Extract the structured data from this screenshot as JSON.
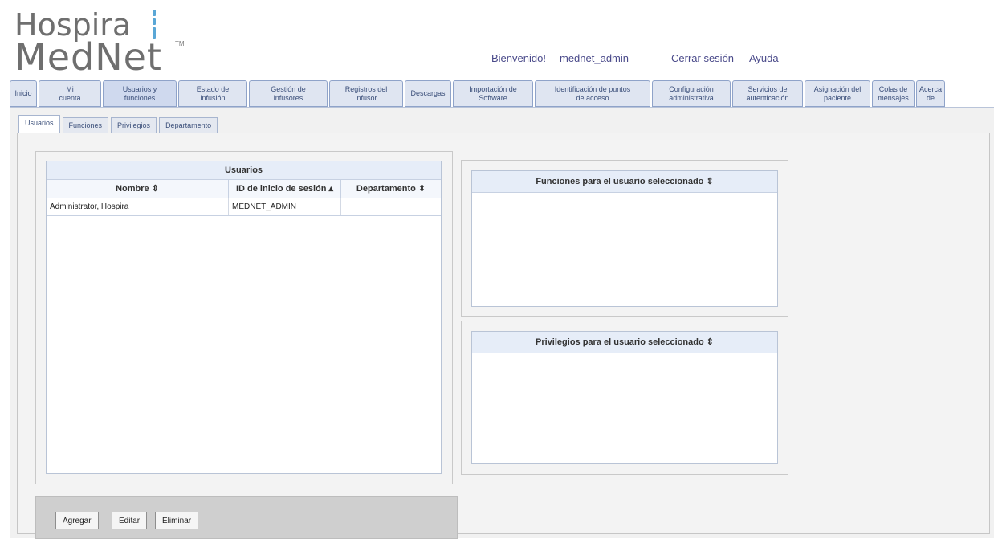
{
  "logo": {
    "line1": "Hospira",
    "line2": "MedNet",
    "tm": "TM"
  },
  "header": {
    "welcome": "Bienvenido!",
    "user": "mednet_admin",
    "logout": "Cerrar sesión",
    "help": "Ayuda"
  },
  "nav": {
    "tabs": [
      {
        "label": "Inicio"
      },
      {
        "label": "Mi\ncuenta"
      },
      {
        "label": "Usuarios y\nfunciones"
      },
      {
        "label": "Estado de\ninfusión"
      },
      {
        "label": "Gestión de\ninfusores"
      },
      {
        "label": "Registros del\ninfusor"
      },
      {
        "label": "Descargas"
      },
      {
        "label": "Importación de\nSoftware"
      },
      {
        "label": "Identificación de puntos\nde acceso"
      },
      {
        "label": "Configuración\nadministrativa"
      },
      {
        "label": "Servicios de\nautenticación"
      },
      {
        "label": "Asignación del\npaciente"
      },
      {
        "label": "Colas de\nmensajes"
      },
      {
        "label": "Acerca\nde"
      }
    ],
    "active_index": 2
  },
  "subtabs": {
    "items": [
      "Usuarios",
      "Funciones",
      "Privilegios",
      "Departamento"
    ],
    "active_index": 0
  },
  "users_table": {
    "title": "Usuarios",
    "columns": [
      "Nombre ⇕",
      "ID de inicio de sesión ▴",
      "Departamento ⇕"
    ],
    "rows": [
      {
        "name": "Administrator, Hospira",
        "login_id": "MEDNET_ADMIN",
        "department": ""
      }
    ]
  },
  "roles_panel": {
    "title": "Funciones para el usuario seleccionado ⇕"
  },
  "privileges_panel": {
    "title": "Privilegios para el usuario seleccionado ⇕"
  },
  "buttons": {
    "add": "Agregar",
    "edit": "Editar",
    "delete": "Eliminar"
  },
  "colors": {
    "tab_bg": "#dfe5f1",
    "tab_border": "#8fa3c9",
    "header_bg": "#e6edf8",
    "logo_accent": "#5aa7d6"
  }
}
